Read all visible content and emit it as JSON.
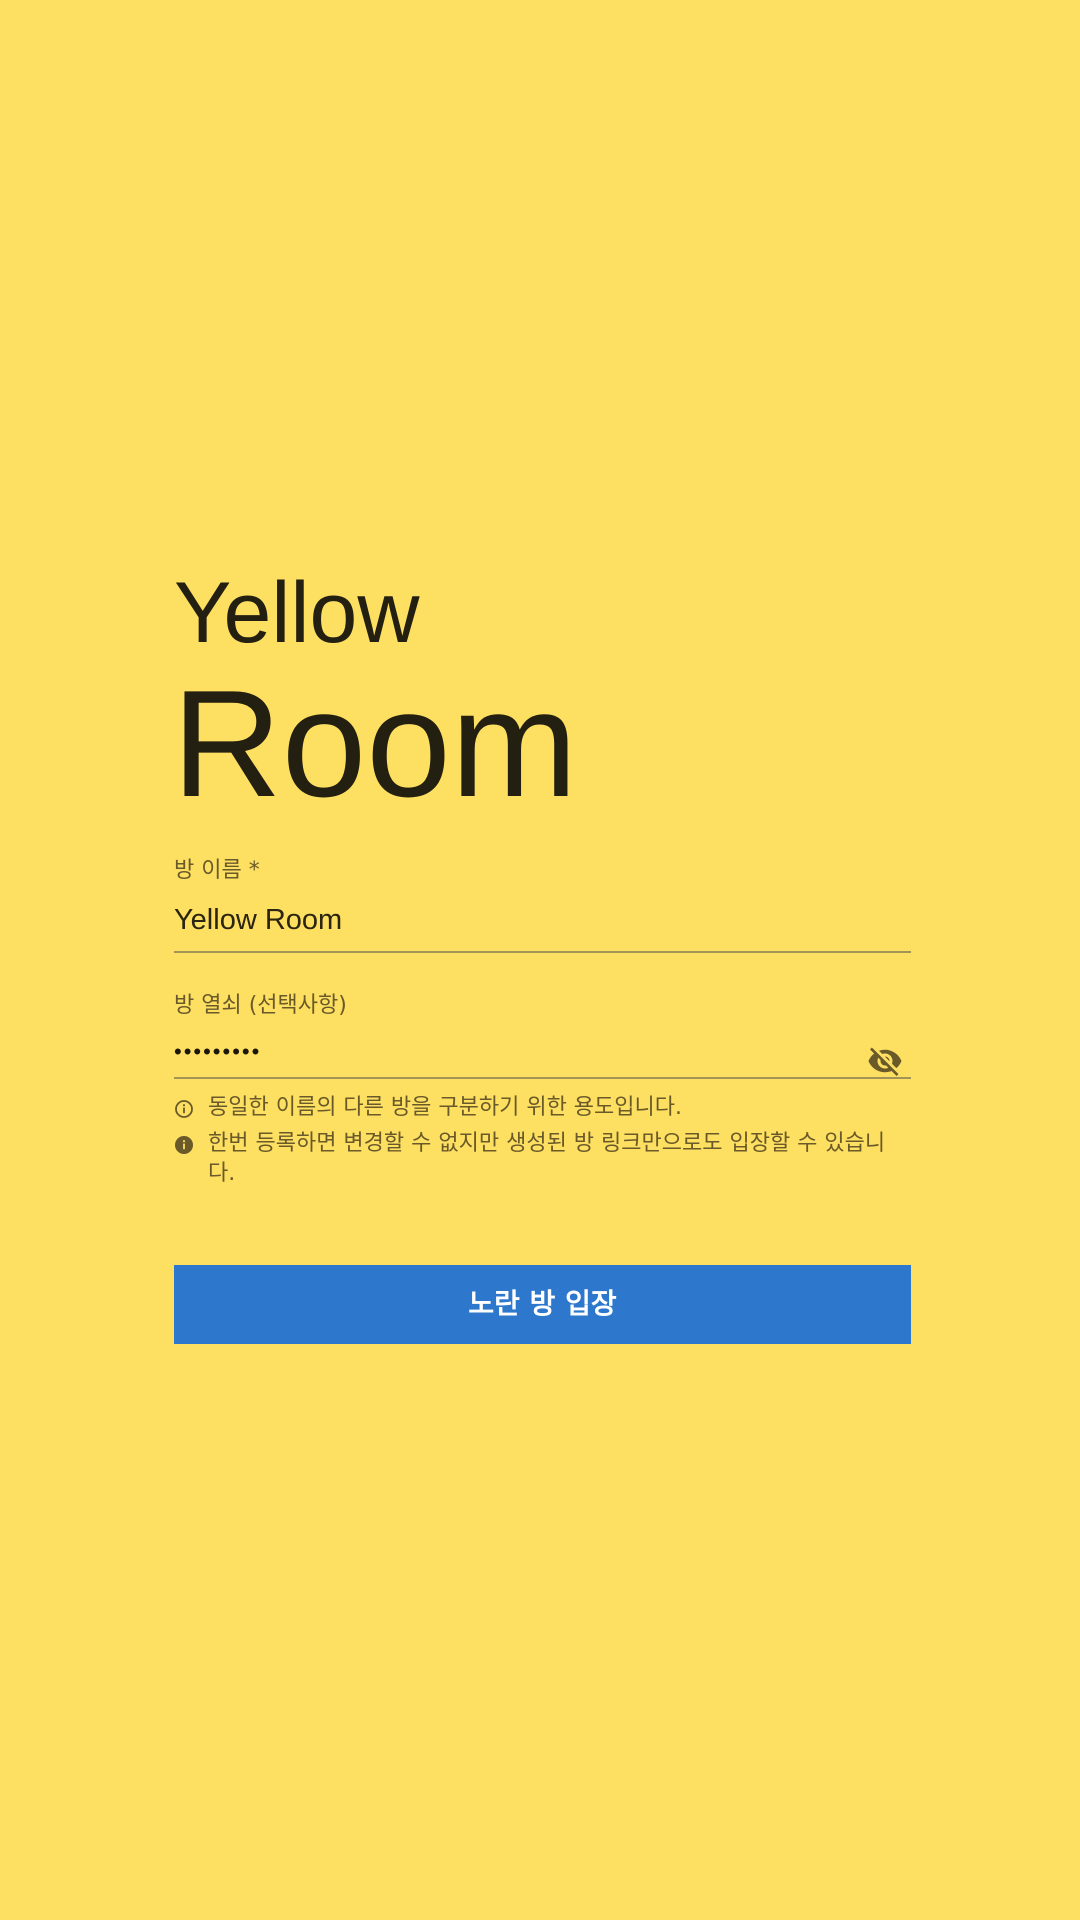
{
  "brand": {
    "line1": "Yellow",
    "line2": "Room"
  },
  "form": {
    "room_name": {
      "label": "방 이름 *",
      "value": "Yellow Room"
    },
    "room_key": {
      "label": "방 열쇠 (선택사항)",
      "value": "•••••••••",
      "toggle_icon": "eye-off-icon"
    },
    "hints": [
      {
        "icon": "info-outline-icon",
        "text": "동일한 이름의 다른 방을 구분하기 위한 용도입니다."
      },
      {
        "icon": "info-filled-icon",
        "text": "한번 등록하면 변경할 수 없지만 생성된 방 링크만으로도 입장할 수 있습니다."
      }
    ],
    "submit_label": "노란 방 입장"
  },
  "colors": {
    "background": "#fddf61",
    "primary": "#2d78cd",
    "text": "#231f11",
    "muted": "#6a5a2a",
    "underline": "#a39456"
  }
}
